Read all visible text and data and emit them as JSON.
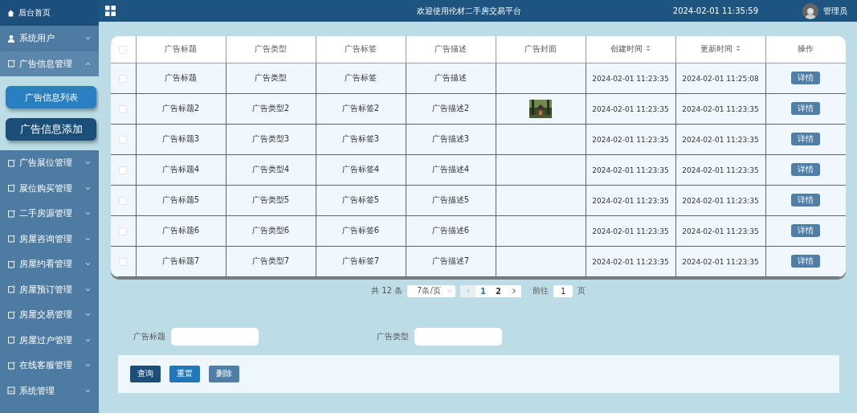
{
  "sidebar": {
    "home": {
      "label": "后台首页"
    },
    "items": [
      {
        "label": "系统用户",
        "kind": "user",
        "expanded": false
      },
      {
        "label": "广告信息管理",
        "kind": "doc",
        "expanded": true,
        "children": [
          {
            "label": "广告信息列表",
            "selected": false
          },
          {
            "label": "广告信息添加",
            "selected": true
          }
        ]
      },
      {
        "label": "广告展位管理",
        "kind": "doc",
        "expanded": false
      },
      {
        "label": "展位购买管理",
        "kind": "doc",
        "expanded": false
      },
      {
        "label": "二手房源管理",
        "kind": "doc",
        "expanded": false
      },
      {
        "label": "房屋咨询管理",
        "kind": "doc",
        "expanded": false
      },
      {
        "label": "房屋约看管理",
        "kind": "doc",
        "expanded": false
      },
      {
        "label": "房屋预订管理",
        "kind": "doc",
        "expanded": false
      },
      {
        "label": "房屋交易管理",
        "kind": "doc",
        "expanded": false
      },
      {
        "label": "房屋过户管理",
        "kind": "doc",
        "expanded": false
      },
      {
        "label": "在线客服管理",
        "kind": "doc",
        "expanded": false
      },
      {
        "label": "系统管理",
        "kind": "board",
        "expanded": false
      }
    ]
  },
  "header": {
    "title": "欢迎使用伦材二手房交易平台",
    "time": "2024-02-01 11:35:59",
    "user": "管理员"
  },
  "table": {
    "select_all": {
      "checked": false
    },
    "columns": [
      {
        "label": "广告标题",
        "sortable": false
      },
      {
        "label": "广告类型",
        "sortable": false
      },
      {
        "label": "广告标签",
        "sortable": false
      },
      {
        "label": "广告描述",
        "sortable": false
      },
      {
        "label": "广告封面",
        "sortable": false
      },
      {
        "label": "创建时间",
        "sortable": true
      },
      {
        "label": "更新时间",
        "sortable": true
      },
      {
        "label": "操作",
        "sortable": false
      }
    ],
    "rows": [
      {
        "checked": false,
        "title": "广告标题",
        "type": "广告类型",
        "tag": "广告标签",
        "desc": "广告描述",
        "created": "2024-02-01 11:23:35",
        "updated": "2024-02-01 11:25:08",
        "action": "详情"
      },
      {
        "checked": false,
        "title": "广告标题2",
        "type": "广告类型2",
        "tag": "广告标签2",
        "desc": "广告描述2",
        "created": "2024-02-01 11:23:35",
        "updated": "2024-02-01 11:23:35",
        "action": "详情"
      },
      {
        "checked": false,
        "title": "广告标题3",
        "type": "广告类型3",
        "tag": "广告标签3",
        "desc": "广告描述3",
        "created": "2024-02-01 11:23:35",
        "updated": "2024-02-01 11:23:35",
        "action": "详情"
      },
      {
        "checked": false,
        "title": "广告标题4",
        "type": "广告类型4",
        "tag": "广告标签4",
        "desc": "广告描述4",
        "created": "2024-02-01 11:23:35",
        "updated": "2024-02-01 11:23:35",
        "action": "详情"
      },
      {
        "checked": false,
        "title": "广告标题5",
        "type": "广告类型5",
        "tag": "广告标签5",
        "desc": "广告描述5",
        "created": "2024-02-01 11:23:35",
        "updated": "2024-02-01 11:23:35",
        "action": "详情"
      },
      {
        "checked": false,
        "title": "广告标题6",
        "type": "广告类型6",
        "tag": "广告标签6",
        "desc": "广告描述6",
        "created": "2024-02-01 11:23:35",
        "updated": "2024-02-01 11:23:35",
        "action": "详情"
      },
      {
        "checked": false,
        "title": "广告标题7",
        "type": "广告类型7",
        "tag": "广告标签7",
        "desc": "广告描述7",
        "created": "2024-02-01 11:23:35",
        "updated": "2024-02-01 11:23:35",
        "action": "详情"
      }
    ]
  },
  "pagination": {
    "total": "共 12 条",
    "page_size": "7条/页",
    "prev_disabled": true,
    "pages": [
      {
        "label": "1",
        "selected": true
      },
      {
        "label": "2",
        "selected": false
      }
    ],
    "goto_label": "前往",
    "goto_value": "1",
    "goto_suffix": "页"
  },
  "search": {
    "fields": [
      {
        "label": "广告标题"
      },
      {
        "label": "广告类型"
      }
    ]
  },
  "buttons": [
    {
      "label": "查询",
      "color": "#1c4e7a"
    },
    {
      "label": "重置",
      "color": "#2178b8"
    },
    {
      "label": "删除",
      "color": "#4f7fa6"
    }
  ]
}
